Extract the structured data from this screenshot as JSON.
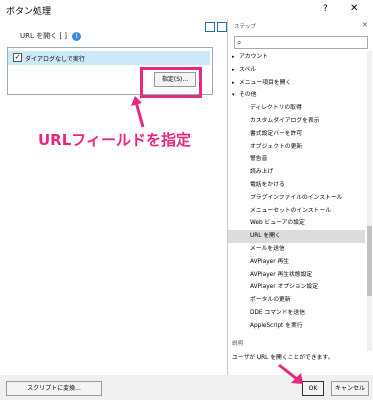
{
  "window": {
    "title": "ボタン処理",
    "help_label": "?",
    "close_label": "✕"
  },
  "script_step": {
    "text": "URL を開く [ ]",
    "info_label": "i"
  },
  "popup": {
    "checkbox_label": "ダイアログなしで実行",
    "checkbox_checked": true,
    "specify_button": "指定(S)..."
  },
  "annotation": {
    "callout": "URLフィールドを指定",
    "color": "#e8287c"
  },
  "steps_panel": {
    "header": "ステップ",
    "close_label": "✕",
    "search": {
      "placeholder": "",
      "value": ""
    },
    "items": [
      {
        "label": "アカウント",
        "type": "category",
        "expanded": false
      },
      {
        "label": "スペル",
        "type": "category",
        "expanded": false
      },
      {
        "label": "メニュー項目を開く",
        "type": "category",
        "expanded": false
      },
      {
        "label": "その他",
        "type": "category",
        "expanded": true
      },
      {
        "label": "ディレクトリの取得",
        "type": "step"
      },
      {
        "label": "カスタムダイアログを表示",
        "type": "step"
      },
      {
        "label": "書式設定バーを許可",
        "type": "step"
      },
      {
        "label": "オブジェクトの更新",
        "type": "step"
      },
      {
        "label": "警告音",
        "type": "step"
      },
      {
        "label": "読み上げ",
        "type": "step"
      },
      {
        "label": "電話をかける",
        "type": "step"
      },
      {
        "label": "プラグインファイルのインストール",
        "type": "step"
      },
      {
        "label": "メニューセットのインストール",
        "type": "step"
      },
      {
        "label": "Web ビューアの設定",
        "type": "step"
      },
      {
        "label": "URL を開く",
        "type": "step",
        "selected": true
      },
      {
        "label": "メールを送信",
        "type": "step"
      },
      {
        "label": "AVPlayer 再生",
        "type": "step"
      },
      {
        "label": "AVPlayer 再生状態設定",
        "type": "step"
      },
      {
        "label": "AVPlayer オプション設定",
        "type": "step"
      },
      {
        "label": "ポータルの更新",
        "type": "step"
      },
      {
        "label": "DDE コマンドを送信",
        "type": "step"
      },
      {
        "label": "AppleScript を実行",
        "type": "step"
      }
    ],
    "description_title": "説明",
    "description_text": "ユーザが URL を開くことができます。"
  },
  "footer": {
    "script_button": "スクリプトに変換...",
    "ok_button": "OK",
    "cancel_button": "キャンセル"
  }
}
